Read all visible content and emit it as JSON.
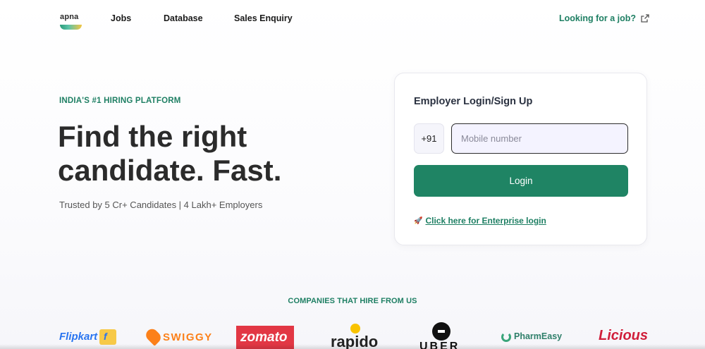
{
  "header": {
    "logo_text": "apna",
    "nav": {
      "jobs": "Jobs",
      "database": "Database",
      "sales": "Sales Enquiry"
    },
    "job_link": "Looking for a job?",
    "job_link_icon": "external-link-icon"
  },
  "hero": {
    "tagline": "INDIA'S #1 HIRING PLATFORM",
    "headline": "Find the right candidate. Fast.",
    "subline": "Trusted by 5 Cr+ Candidates | 4 Lakh+ Employers"
  },
  "login_card": {
    "title": "Employer Login/Sign Up",
    "country_code": "+91",
    "mobile_placeholder": "Mobile number",
    "mobile_value": "",
    "login_label": "Login",
    "enterprise_icon": "rocket-icon",
    "enterprise_text": "Click here for Enterprise login"
  },
  "companies": {
    "title": "COMPANIES THAT HIRE FROM US",
    "logos": {
      "flipkart": "Flipkart",
      "flipkart_badge": "f",
      "swiggy": "SWIGGY",
      "zomato": "zomato",
      "rapido": "rapido",
      "uber": "UBER",
      "pharmeasy": "PharmEasy",
      "licious": "Licious"
    }
  },
  "colors": {
    "accent": "#1e7f63",
    "button": "#1f8464",
    "input_bg": "#f4f3ff"
  }
}
